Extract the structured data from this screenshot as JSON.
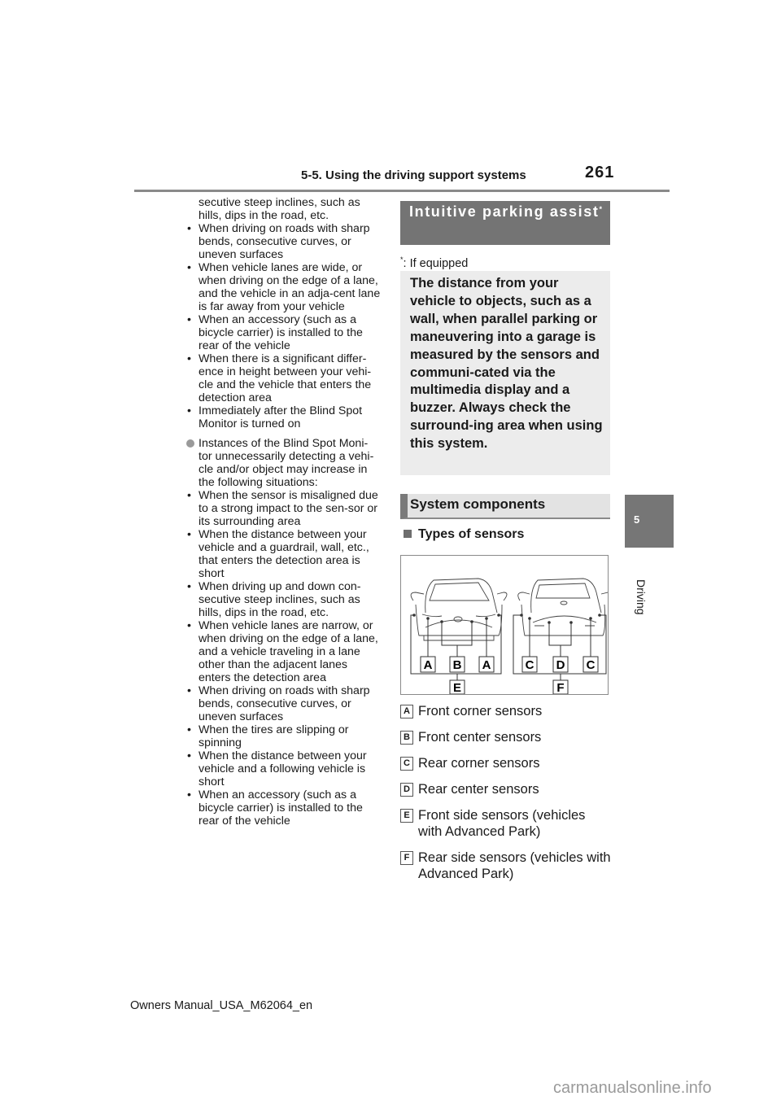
{
  "header": {
    "section": "5-5. Using the driving support systems",
    "page_number": "261"
  },
  "left_column": {
    "continuation": [
      "secutive steep inclines, such as",
      "hills, dips in the road, etc."
    ],
    "bullets_a": [
      "When driving on roads with sharp bends, consecutive curves, or uneven surfaces",
      "When vehicle lanes are wide, or when driving on the edge of a lane, and the vehicle in an adja-cent lane is far away from your vehicle",
      "When an accessory (such as a bicycle carrier) is installed to the rear of the vehicle",
      "When there is a significant differ-ence in height between your vehi-cle and the vehicle that enters the detection area",
      "Immediately after the Blind Spot Monitor is turned on"
    ],
    "circle_note": "Instances of the Blind Spot Moni-tor unnecessarily detecting a vehi-cle and/or object may increase in the following situations:",
    "bullets_b": [
      "When the sensor is misaligned due to a strong impact to the sen-sor or its surrounding area",
      "When the distance between your vehicle and a guardrail, wall, etc., that enters the detection area is short",
      "When driving up and down con-secutive steep inclines, such as hills, dips in the road, etc.",
      "When vehicle lanes are narrow, or when driving on the edge of a lane, and a vehicle traveling in a lane other than the adjacent lanes enters the detection area",
      "When driving on roads with sharp bends, consecutive curves, or uneven surfaces",
      "When the tires are slipping or spinning",
      "When the distance between your vehicle and a following vehicle is short",
      "When an accessory (such as a bicycle carrier) is installed to the rear of the vehicle"
    ]
  },
  "right_column": {
    "section_heading": "Intuitive parking assist",
    "section_heading_mark": "*",
    "footnote_mark": "*",
    "footnote": ": If equipped",
    "intro": "The distance from your vehicle to objects, such as a wall, when parallel parking or maneuvering into a garage is measured by the sensors and communi-cated via the multimedia display and a buzzer. Always check the surround-ing area when using this system.",
    "subheading": "System components",
    "types_heading": "Types of sensors",
    "diagram": {
      "front_labels": [
        "A",
        "B",
        "A"
      ],
      "front_bottom_label": "E",
      "rear_labels": [
        "C",
        "D",
        "C"
      ],
      "rear_bottom_label": "F"
    },
    "legend": [
      {
        "key": "A",
        "text": "Front corner sensors"
      },
      {
        "key": "B",
        "text": "Front center sensors"
      },
      {
        "key": "C",
        "text": "Rear corner sensors"
      },
      {
        "key": "D",
        "text": "Rear center sensors"
      },
      {
        "key": "E",
        "text": "Front side sensors (vehicles with Advanced Park)"
      },
      {
        "key": "F",
        "text": "Rear side sensors (vehicles with Advanced Park)"
      }
    ]
  },
  "side_tab": {
    "number": "5",
    "label": "Driving"
  },
  "footer": {
    "manual_id": "Owners Manual_USA_M62064_en"
  },
  "watermark": "carmanualsonline.info"
}
